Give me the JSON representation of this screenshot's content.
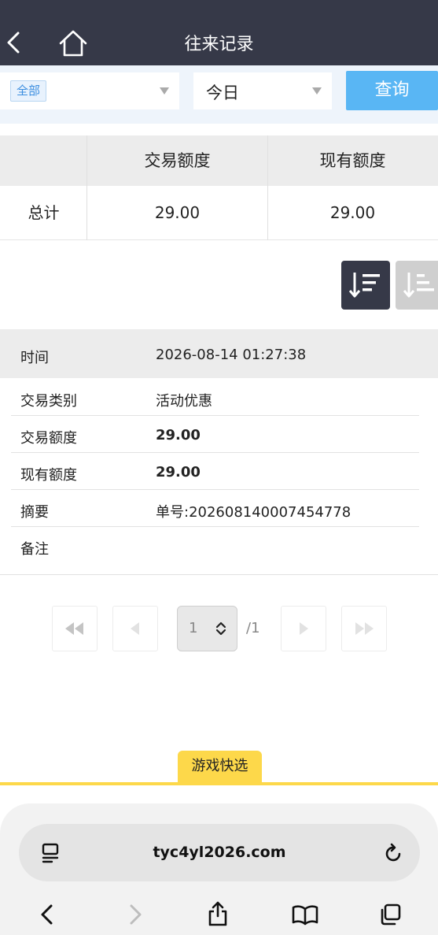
{
  "header": {
    "title": "往来记录"
  },
  "filter": {
    "type_selected": "全部",
    "date_selected": "今日",
    "query_label": "查询"
  },
  "summary": {
    "columns": [
      "",
      "交易额度",
      "现有额度"
    ],
    "row": {
      "label": "总计",
      "trade_amount": "29.00",
      "current_amount": "29.00"
    }
  },
  "record": {
    "time_label": "时间",
    "time_value": "2026-08-14 01:27:38",
    "rows": [
      {
        "label": "交易类别",
        "value": "活动优惠"
      },
      {
        "label": "交易额度",
        "value": "29.00"
      },
      {
        "label": "现有额度",
        "value": "29.00"
      },
      {
        "label": "摘要",
        "value": "单号:202608140007454778"
      },
      {
        "label": "备注",
        "value": ""
      }
    ]
  },
  "pagination": {
    "current_page": "1",
    "total": "/1"
  },
  "quick_select": {
    "label": "游戏快选"
  },
  "browser": {
    "url": "tyc4yl2026.com"
  },
  "colors": {
    "header_bg": "#363948",
    "accent_blue": "#59b6f4",
    "sort_active": "#363948",
    "sort_inactive": "#cfcfcf",
    "quick_yellow": "#fdd84a"
  },
  "icons": [
    "back-icon",
    "home-icon",
    "sort-desc-icon",
    "sort-asc-icon",
    "first-page-icon",
    "prev-page-icon",
    "next-page-icon",
    "last-page-icon",
    "reader-icon",
    "reload-icon",
    "share-icon",
    "bookmarks-icon",
    "tabs-icon"
  ]
}
